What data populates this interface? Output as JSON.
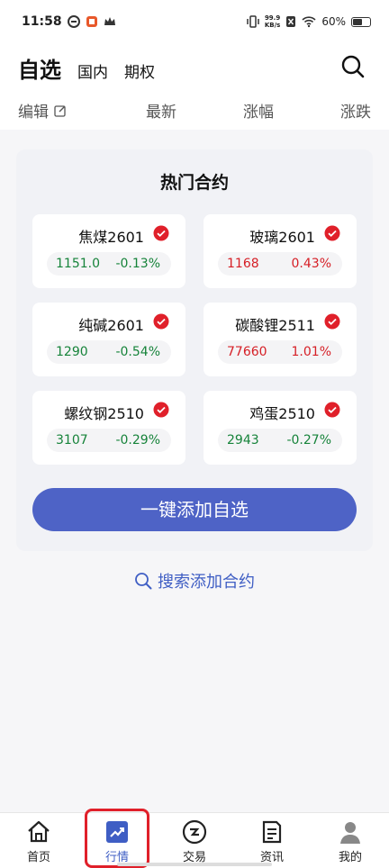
{
  "status_bar": {
    "time": "11:58",
    "speed_top": "99.9",
    "speed_unit": "KB/s",
    "battery": "60%",
    "battery_level": 0.6
  },
  "header": {
    "title": "自选",
    "tabs": [
      "国内",
      "期权"
    ],
    "columns": {
      "edit": "编辑",
      "latest": "最新",
      "change_pct": "涨幅",
      "change": "涨跌"
    }
  },
  "hot": {
    "title": "热门合约",
    "contracts": [
      {
        "name": "焦煤2601",
        "price": "1151.0",
        "change": "-0.13%",
        "trend": "down"
      },
      {
        "name": "玻璃2601",
        "price": "1168",
        "change": "0.43%",
        "trend": "up"
      },
      {
        "name": "纯碱2601",
        "price": "1290",
        "change": "-0.54%",
        "trend": "down"
      },
      {
        "name": "碳酸锂2511",
        "price": "77660",
        "change": "1.01%",
        "trend": "up"
      },
      {
        "name": "螺纹钢2510",
        "price": "3107",
        "change": "-0.29%",
        "trend": "down"
      },
      {
        "name": "鸡蛋2510",
        "price": "2943",
        "change": "-0.27%",
        "trend": "down"
      }
    ],
    "add_button": "一键添加自选"
  },
  "search_add": "搜索添加合约",
  "nav": {
    "items": [
      {
        "label": "首页",
        "icon": "home-icon"
      },
      {
        "label": "行情",
        "icon": "trend-chart-icon"
      },
      {
        "label": "交易",
        "icon": "exchange-icon"
      },
      {
        "label": "资讯",
        "icon": "news-icon"
      },
      {
        "label": "我的",
        "icon": "profile-icon"
      }
    ],
    "active_index": 1
  },
  "colors": {
    "up": "#d61f26",
    "down": "#16833a",
    "accent": "#4e63c6",
    "highlight": "#e0202a"
  }
}
